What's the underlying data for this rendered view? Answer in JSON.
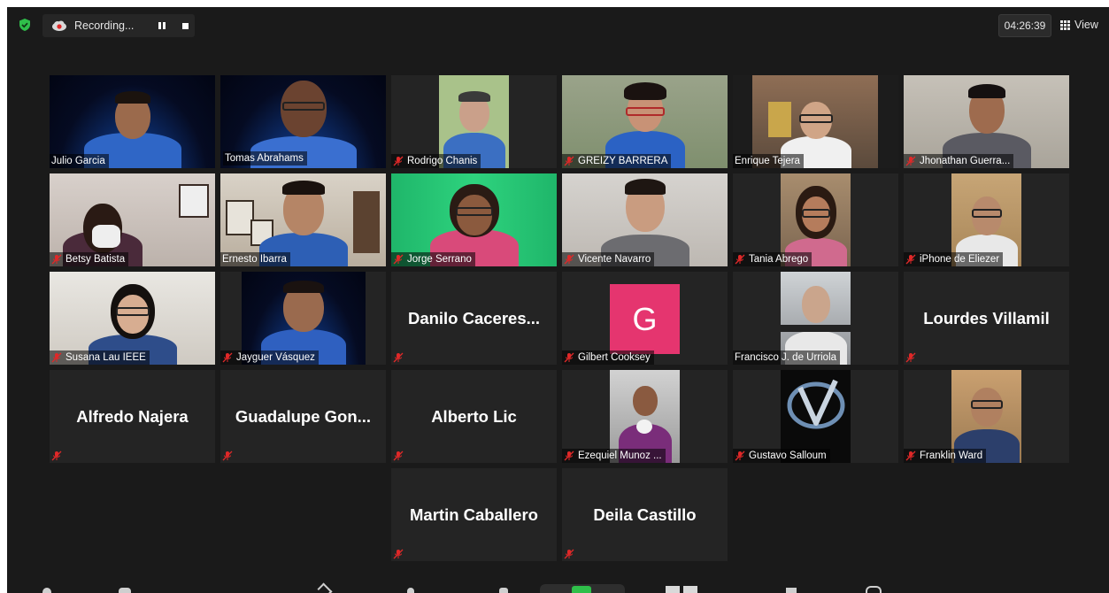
{
  "topbar": {
    "recording_label": "Recording...",
    "clock": "04:26:39",
    "view_label": "View"
  },
  "tiles": [
    {
      "name": "Julio Garcia",
      "muted": false,
      "type": "video"
    },
    {
      "name": "Tomas Abrahams",
      "muted": false,
      "type": "video",
      "active_speaker": true
    },
    {
      "name": "Rodrigo Chanis",
      "muted": true,
      "type": "video"
    },
    {
      "name": "GREIZY BARRERA",
      "muted": true,
      "type": "video"
    },
    {
      "name": "Enrique Tejera",
      "muted": false,
      "type": "video"
    },
    {
      "name": "Jhonathan Guerra...",
      "muted": true,
      "type": "video"
    },
    {
      "name": "Betsy Batista",
      "muted": true,
      "type": "video"
    },
    {
      "name": "Ernesto Ibarra",
      "muted": false,
      "type": "video"
    },
    {
      "name": "Jorge Serrano",
      "muted": true,
      "type": "video"
    },
    {
      "name": "Vicente Navarro",
      "muted": true,
      "type": "video"
    },
    {
      "name": "Tania Abrego",
      "muted": true,
      "type": "video"
    },
    {
      "name": "iPhone de Eliezer",
      "muted": true,
      "type": "video"
    },
    {
      "name": "Susana Lau IEEE",
      "muted": true,
      "type": "video"
    },
    {
      "name": "Jayguer Vásquez",
      "muted": true,
      "type": "video"
    },
    {
      "name": "Danilo  Caceres...",
      "muted": true,
      "type": "name-only"
    },
    {
      "name": "Gilbert Cooksey",
      "muted": true,
      "type": "avatar",
      "avatar_letter": "G",
      "avatar_color": "#e5356f"
    },
    {
      "name": "Francisco J. de Urriola",
      "muted": false,
      "type": "video"
    },
    {
      "name": "Lourdes Villamil",
      "muted": true,
      "type": "name-only"
    },
    {
      "name": "Alfredo Najera",
      "muted": true,
      "type": "name-only"
    },
    {
      "name": "Guadalupe  Gon...",
      "muted": true,
      "type": "name-only"
    },
    {
      "name": "Alberto Lic",
      "muted": true,
      "type": "name-only"
    },
    {
      "name": "Ezequiel Munoz ...",
      "muted": true,
      "type": "video"
    },
    {
      "name": "Gustavo Salloum",
      "muted": true,
      "type": "logo"
    },
    {
      "name": "Franklin Ward",
      "muted": true,
      "type": "video"
    },
    {
      "name": "Martin Caballero",
      "muted": true,
      "type": "name-only"
    },
    {
      "name": "Deila Castillo",
      "muted": true,
      "type": "name-only"
    }
  ],
  "colors": {
    "background": "#1a1a1a",
    "tile": "#242424",
    "active_speaker_border": "#c7e04a",
    "muted_icon": "#e02828",
    "shield": "#2fbf4a"
  }
}
